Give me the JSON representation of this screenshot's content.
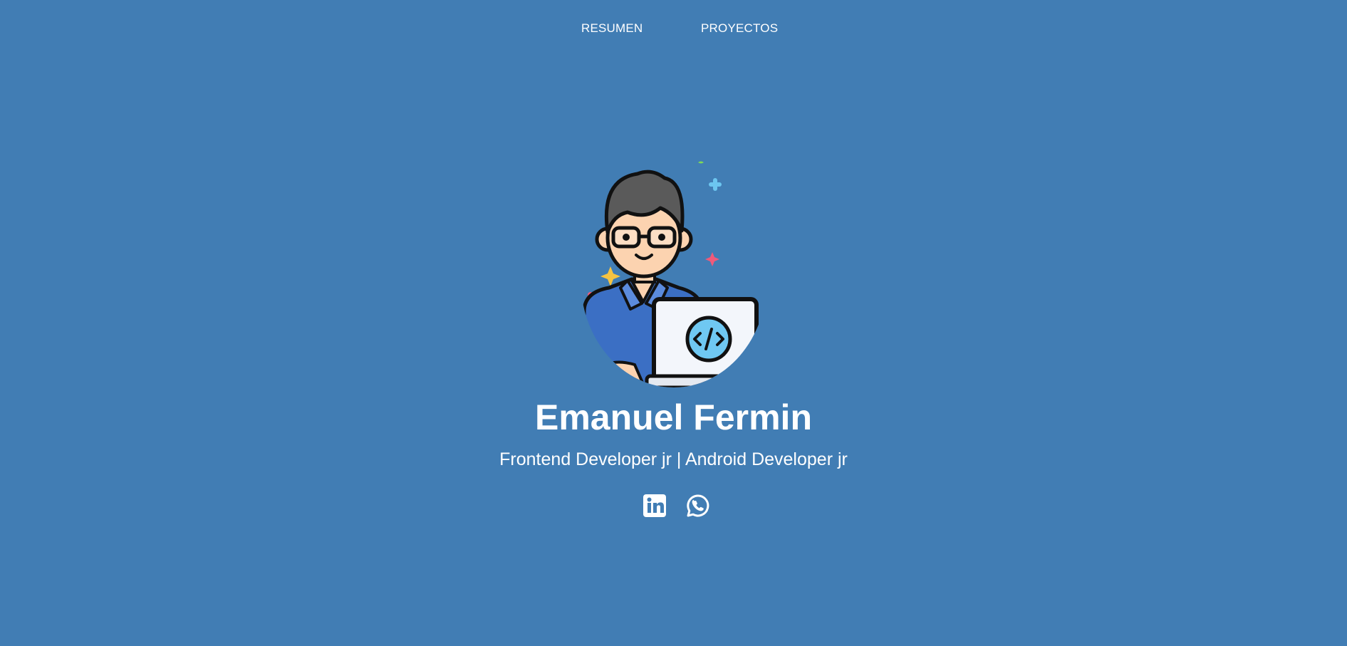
{
  "nav": {
    "items": [
      {
        "label": "RESUMEN"
      },
      {
        "label": "PROYECTOS"
      }
    ]
  },
  "profile": {
    "name": "Emanuel Fermin",
    "tagline": "Frontend Developer jr | Android Developer jr",
    "avatar_icon": "developer-avatar-icon"
  },
  "socials": [
    {
      "icon": "linkedin-icon"
    },
    {
      "icon": "whatsapp-icon"
    }
  ],
  "colors": {
    "background": "#417db4",
    "text": "#ffffff",
    "shirt": "#3b6fc4",
    "hair": "#5a5a5a",
    "skin": "#fcd3b0",
    "screen_badge": "#6fc8f2"
  }
}
